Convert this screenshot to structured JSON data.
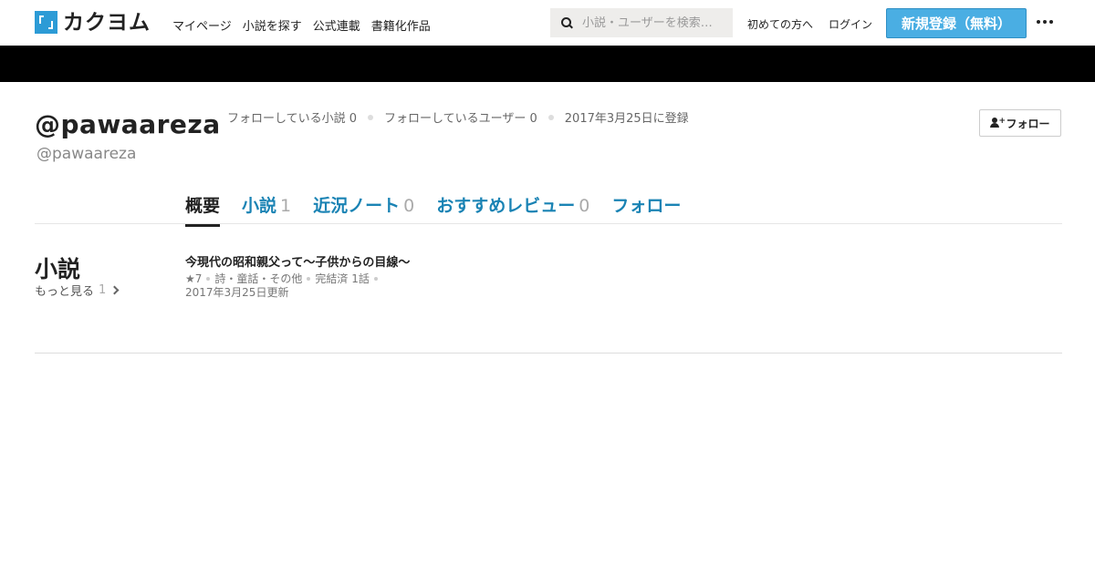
{
  "header": {
    "logo_text": "カクヨム",
    "nav": [
      "マイページ",
      "小説を探す",
      "公式連載",
      "書籍化作品"
    ],
    "search_placeholder": "小説・ユーザーを検索…",
    "beginners": "初めての方へ",
    "login": "ログイン",
    "signup": "新規登録（無料）"
  },
  "profile": {
    "display_name": "@pawaareza",
    "user_id": "@pawaareza",
    "following_novels": "フォローしている小説 0",
    "following_users": "フォローしているユーザー 0",
    "registered": "2017年3月25日に登録",
    "follow_button": "フォロー"
  },
  "tabs": [
    {
      "label": "概要",
      "count": ""
    },
    {
      "label": "小説",
      "count": "1"
    },
    {
      "label": "近況ノート",
      "count": "0"
    },
    {
      "label": "おすすめレビュー",
      "count": "0"
    },
    {
      "label": "フォロー",
      "count": ""
    }
  ],
  "novels": {
    "section_title": "小説",
    "more_label": "もっと見る",
    "more_count": "1",
    "items": [
      {
        "title": "今現代の昭和親父って～子供からの目線～",
        "stars": "★7",
        "genre": "詩・童話・その他",
        "status": "完結済 1話",
        "updated": "2017年3月25日更新"
      }
    ]
  },
  "colors": {
    "accent": "#1a83b4",
    "signup_bg": "#4aaee3",
    "logo_blue": "#2c9bd6",
    "banner": "#000000"
  }
}
